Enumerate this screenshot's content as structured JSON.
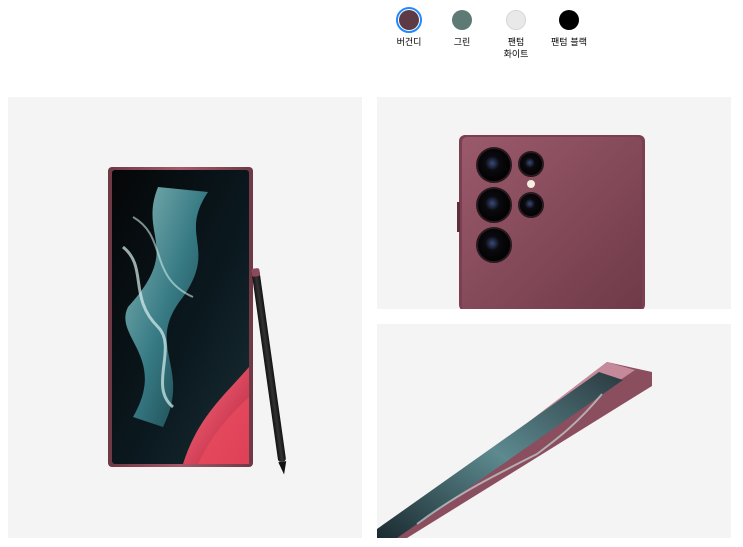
{
  "colors": [
    {
      "label": "버건디",
      "hex": "#5c3b47",
      "selected": true
    },
    {
      "label": "그린",
      "hex": "#5d7a74",
      "selected": false
    },
    {
      "label": "팬텀\n화이트",
      "hex": "#e9e9e9",
      "selected": false
    },
    {
      "label": "팬텀 블랙",
      "hex": "#000000",
      "selected": false
    }
  ],
  "gallery": {
    "front_image": "phone-front-with-s-pen",
    "back_image": "phone-back-camera-closeup",
    "side_image": "phone-side-angle"
  },
  "accent": "#2189ff",
  "panel_bg": "#f4f4f4"
}
